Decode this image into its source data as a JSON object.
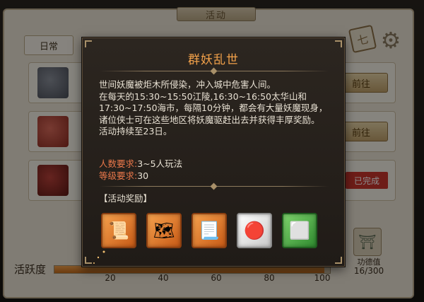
{
  "background": {
    "title": "活动",
    "tab": "日常",
    "rows": [
      {
        "button": "前往"
      },
      {
        "button": "前往"
      },
      {
        "status": "已完成"
      }
    ],
    "progress": {
      "label": "活跃度",
      "fill_fraction": 0.98,
      "ticks": [
        "20",
        "40",
        "60",
        "80",
        "100"
      ]
    },
    "merit": {
      "label": "功德值",
      "value": "16/300"
    }
  },
  "popup": {
    "title": "群妖乱世",
    "description": "世间妖魔被炬木所侵染，冲入城中危害人间。\n在每天的15:30~15:50江陵,16:30~16:50太华山和17:30~17:50海市，每隔10分钟，都会有大量妖魔现身，诸位侠士可在这些地区将妖魔驱赶出去并获得丰厚奖励。\n活动持续至23日。",
    "players_label": "人数要求:",
    "players_value": "3~5人玩法",
    "level_label": "等级要求:",
    "level_value": "30",
    "rewards_title": "【活动奖励】",
    "rewards": [
      {
        "icon": "scroll-bundle-icon",
        "glyph": "📜",
        "rarity": "orange"
      },
      {
        "icon": "map-scroll-icon",
        "glyph": "🗺",
        "rarity": "orange"
      },
      {
        "icon": "skill-scroll-icon",
        "glyph": "📃",
        "rarity": "orange"
      },
      {
        "icon": "red-gem-icon",
        "glyph": "🔴",
        "rarity": "white"
      },
      {
        "icon": "silver-ingot-icon",
        "glyph": "⬜",
        "rarity": "green"
      }
    ]
  }
}
